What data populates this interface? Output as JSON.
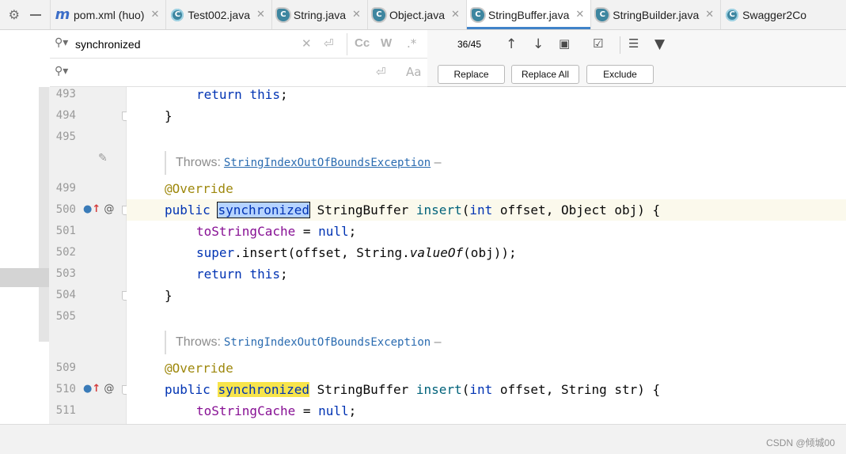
{
  "tabs": [
    {
      "label": "pom.xml (huo)",
      "icon": "maven-icon",
      "active": false
    },
    {
      "label": "Test002.java",
      "icon": "class-icon",
      "active": false
    },
    {
      "label": "String.java",
      "icon": "library-class-icon",
      "active": false
    },
    {
      "label": "Object.java",
      "icon": "library-class-icon",
      "active": false
    },
    {
      "label": "StringBuffer.java",
      "icon": "library-class-icon",
      "active": true
    },
    {
      "label": "StringBuilder.java",
      "icon": "library-class-icon",
      "active": false
    },
    {
      "label": "Swagger2Co",
      "icon": "class-icon",
      "active": false
    }
  ],
  "search": {
    "find_value": "synchronized",
    "replace_value": "",
    "match_case_label": "Cc",
    "words_label": "W",
    "regex_label": ".*",
    "counter": "36/45",
    "replace_label": "Replace",
    "replace_all_label": "Replace All",
    "exclude_label": "Exclude"
  },
  "line_numbers": [
    "493",
    "494",
    "495",
    "499",
    "500",
    "501",
    "502",
    "503",
    "504",
    "505",
    "509",
    "510",
    "511"
  ],
  "code": {
    "l493_kw": "return",
    "l493_this": "this",
    "l494": "}",
    "doc_throws": "Throws:",
    "doc_exception": "StringIndexOutOfBoundsException",
    "doc_dash": "–",
    "l499": "@Override",
    "l500_public": "public",
    "l500_sync": "synchronized",
    "l500_type": "StringBuffer",
    "l500_method": "insert",
    "l500_int": "int",
    "l500_rest1": "offset, Object obj) {",
    "l501_field": "toStringCache",
    "l501_eq": " = ",
    "l501_null": "null",
    "l502_super": "super",
    "l502_rest": ".insert(offset, String.",
    "l502_valueof": "valueOf",
    "l502_end": "(obj));",
    "l503_kw": "return",
    "l503_this": "this",
    "l504": "}",
    "l509": "@Override",
    "l510_public": "public",
    "l510_sync": "synchronized",
    "l510_type": "StringBuffer",
    "l510_method": "insert",
    "l510_int": "int",
    "l510_rest1": "offset, String str) {",
    "l511_field": "toStringCache",
    "l511_eq": " = ",
    "l511_null": "null"
  },
  "watermark": "CSDN @倾城00",
  "colors": {
    "keyword": "#0033b3",
    "annotation": "#9e880d",
    "field": "#871094",
    "method": "#00627a",
    "match_highlight": "#f7e44b",
    "current_match": "#b5d3ff",
    "active_tab_accent": "#4083c9"
  }
}
